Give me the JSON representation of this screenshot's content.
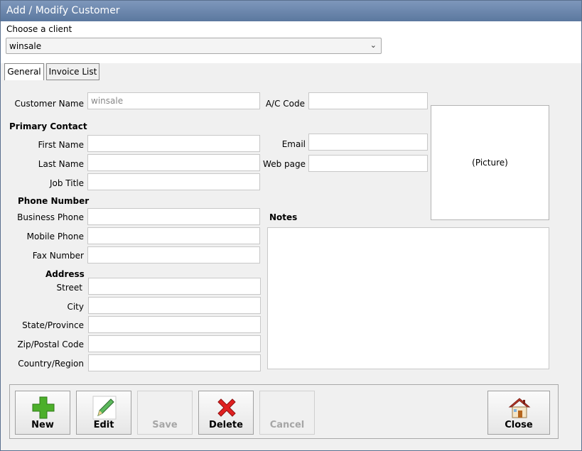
{
  "window": {
    "title": "Add / Modify Customer"
  },
  "chooser": {
    "label": "Choose a client",
    "selected": "winsale"
  },
  "tabs": [
    {
      "label": "General",
      "active": true
    },
    {
      "label": "Invoice List",
      "active": false
    }
  ],
  "form": {
    "customer_name": {
      "label": "Customer Name",
      "value": "winsale"
    },
    "ac_code": {
      "label": "A/C Code",
      "value": ""
    },
    "primary_contact": "Primary Contact",
    "first_name": {
      "label": "First Name",
      "value": ""
    },
    "last_name": {
      "label": "Last Name",
      "value": ""
    },
    "job_title": {
      "label": "Job Title",
      "value": ""
    },
    "email": {
      "label": "Email",
      "value": ""
    },
    "web_page": {
      "label": "Web page",
      "value": ""
    },
    "phone_number": "Phone Number",
    "business_phone": {
      "label": "Business Phone",
      "value": ""
    },
    "mobile_phone": {
      "label": "Mobile Phone",
      "value": ""
    },
    "fax_number": {
      "label": "Fax Number",
      "value": ""
    },
    "address": "Address",
    "street": {
      "label": "Street",
      "value": ""
    },
    "city": {
      "label": "City",
      "value": ""
    },
    "state": {
      "label": "State/Province",
      "value": ""
    },
    "zip": {
      "label": "Zip/Postal Code",
      "value": ""
    },
    "country": {
      "label": "Country/Region",
      "value": ""
    },
    "notes_label": "Notes",
    "picture_label": "(Picture)"
  },
  "toolbar": {
    "new": {
      "label": "New",
      "enabled": true,
      "icon": "plus-icon"
    },
    "edit": {
      "label": "Edit",
      "enabled": true,
      "icon": "pencil-icon"
    },
    "save": {
      "label": "Save",
      "enabled": false,
      "icon": "none"
    },
    "delete": {
      "label": "Delete",
      "enabled": true,
      "icon": "red-x-icon"
    },
    "cancel": {
      "label": "Cancel",
      "enabled": false,
      "icon": "none"
    },
    "close": {
      "label": "Close",
      "enabled": true,
      "icon": "house-icon"
    }
  },
  "colors": {
    "title_bar": "#6a85ab",
    "add_green": "#4caf2a",
    "delete_red": "#e02020"
  }
}
